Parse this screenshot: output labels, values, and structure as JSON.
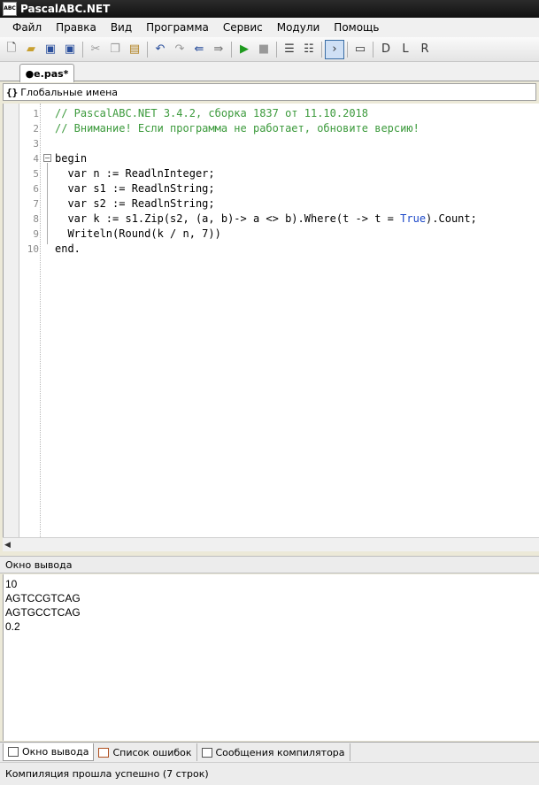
{
  "window": {
    "title": "PascalABC.NET",
    "icon_text": "ABC"
  },
  "menu": [
    "Файл",
    "Правка",
    "Вид",
    "Программа",
    "Сервис",
    "Модули",
    "Помощь"
  ],
  "toolbar_icons": [
    "new-file-icon",
    "open-icon",
    "save-icon",
    "save-all-icon",
    "cut-icon",
    "copy-icon",
    "paste-icon",
    "undo-icon",
    "redo-icon",
    "format-icon",
    "comment-icon",
    "run-icon",
    "stop-icon",
    "step-over-icon",
    "step-into-icon",
    "output-window-icon",
    "form-icon",
    "module-icon",
    "debug-icon",
    "watch-icon"
  ],
  "editor_tab": {
    "label": "●e.pas*"
  },
  "scope": {
    "icon": "{}",
    "label": "Глобальные имена"
  },
  "code": {
    "line_numbers": [
      "1",
      "2",
      "3",
      "4",
      "5",
      "6",
      "7",
      "8",
      "9",
      "10"
    ],
    "lines": [
      "// PascalABC.NET 3.4.2, сборка 1837 от 11.10.2018",
      "// Внимание! Если программа не работает, обновите версию!",
      "",
      "begin",
      "  var n := ReadlnInteger;",
      "  var s1 := ReadlnString;",
      "  var s2 := ReadlnString;",
      "  var k := s1.Zip(s2, (a, b)-> a <> b).Where(t -> t = ",
      "  Writeln(Round(k / n, 7))",
      "end."
    ],
    "line8_true": "True",
    "line8_tail": ").Count;",
    "fold_begin": "−"
  },
  "output": {
    "header": "Окно вывода",
    "lines": [
      "10",
      "AGTCCGTCAG",
      "AGTGCCTCAG",
      "0.2"
    ]
  },
  "bottom_tabs": [
    "Окно вывода",
    "Список ошибок",
    "Сообщения компилятора"
  ],
  "status": "Компиляция прошла успешно (7 строк)"
}
